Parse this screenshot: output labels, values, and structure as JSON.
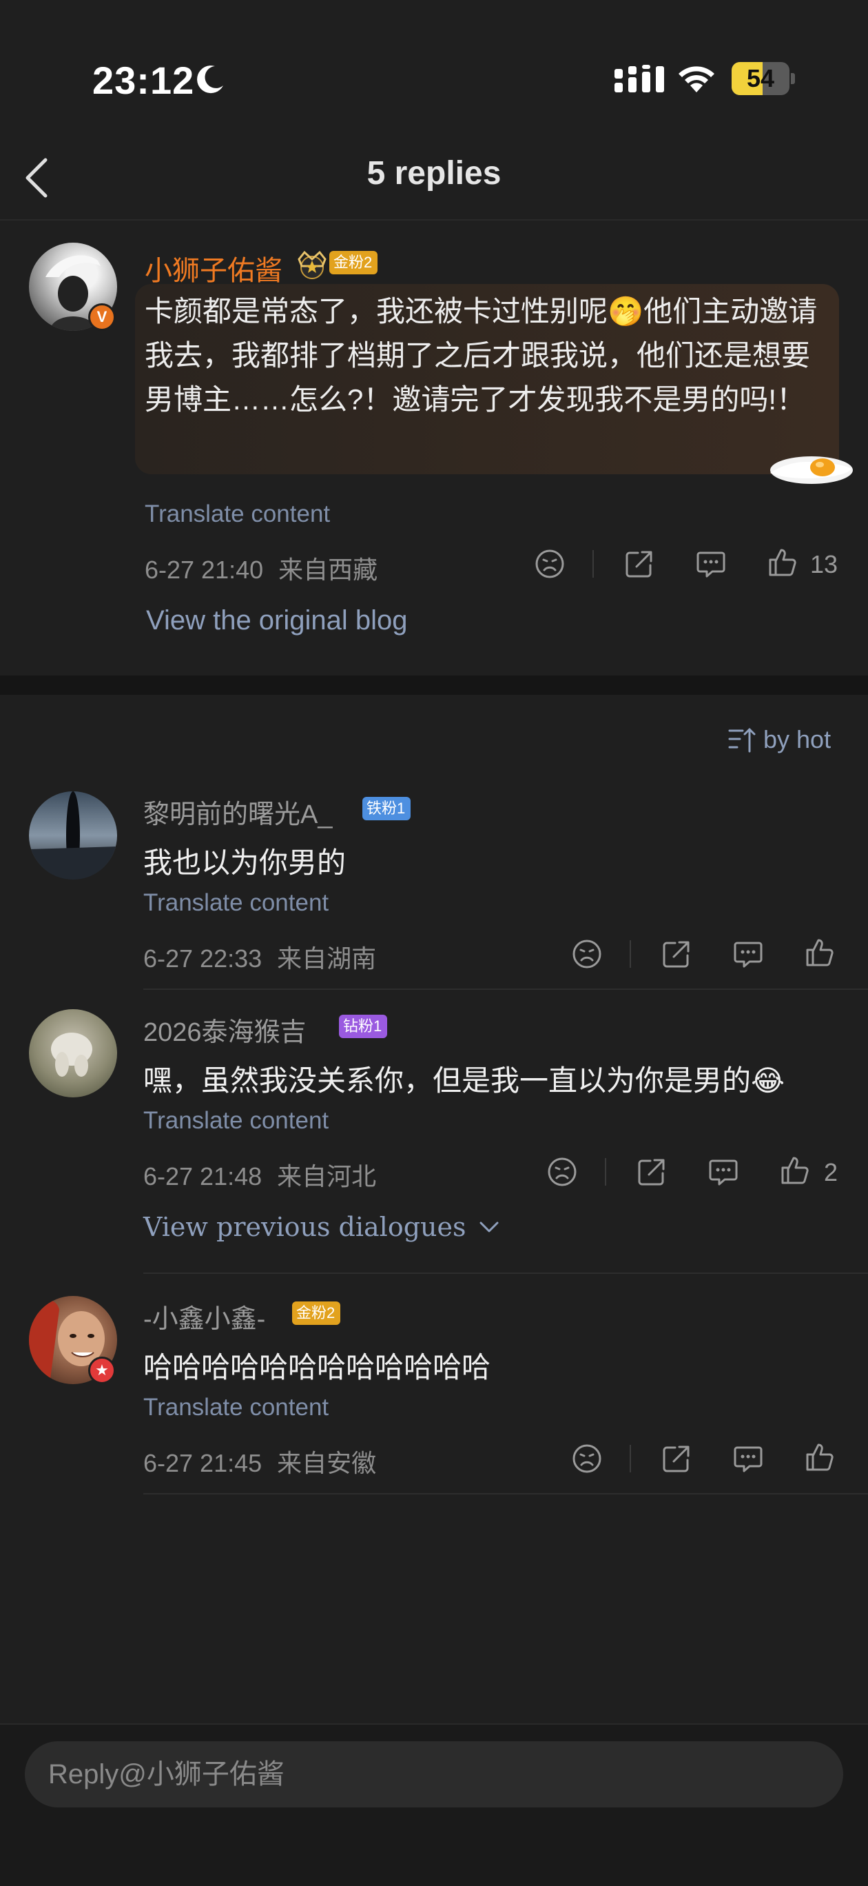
{
  "status_bar": {
    "time": "23:12",
    "battery_level": 54,
    "battery_text": "54"
  },
  "nav": {
    "title": "5 replies"
  },
  "main_comment": {
    "user_name": "小狮子佑酱",
    "fan_badge": "金粉2",
    "text": "卡颜都是常态了，我还被卡过性别呢🤭他们主动邀请我去，我都排了档期了之后才跟我说，他们还是想要男博主……怎么?！邀请完了才发现我不是男的吗!！",
    "translate_label": "Translate content",
    "time": "6-27 21:40",
    "location": "来自西藏",
    "like_count": "13",
    "view_blog_label": "View the original blog"
  },
  "sort": {
    "label": "by hot"
  },
  "replies": [
    {
      "user_name": "黎明前的曙光A_",
      "fan_badge": "铁粉1",
      "text": "我也以为你男的",
      "translate_label": "Translate content",
      "time": "6-27 22:33",
      "location": "来自湖南",
      "like_count": ""
    },
    {
      "user_name": "2026泰海猴吉",
      "fan_badge": "钻粉1",
      "text": "嘿，虽然我没关系你，但是我一直以为你是男的😂",
      "translate_label": "Translate content",
      "time": "6-27 21:48",
      "location": "来自河北",
      "like_count": "2",
      "view_previous_label": "View previous dialogues"
    },
    {
      "user_name": "-小鑫小鑫-",
      "fan_badge": "金粉2",
      "text": "哈哈哈哈哈哈哈哈哈哈哈哈",
      "translate_label": "Translate content",
      "time": "6-27 21:45",
      "location": "来自安徽",
      "like_count": ""
    }
  ],
  "reply_bar": {
    "placeholder": "Reply@小狮子佑酱"
  },
  "colors": {
    "background": "#1f1f1f",
    "vip_name": "#f07a22",
    "link": "#8fa0bd",
    "gold_badge": "#e2a21e",
    "iron_badge": "#4d8fe0",
    "diamond_badge": "#9a5ae0"
  }
}
